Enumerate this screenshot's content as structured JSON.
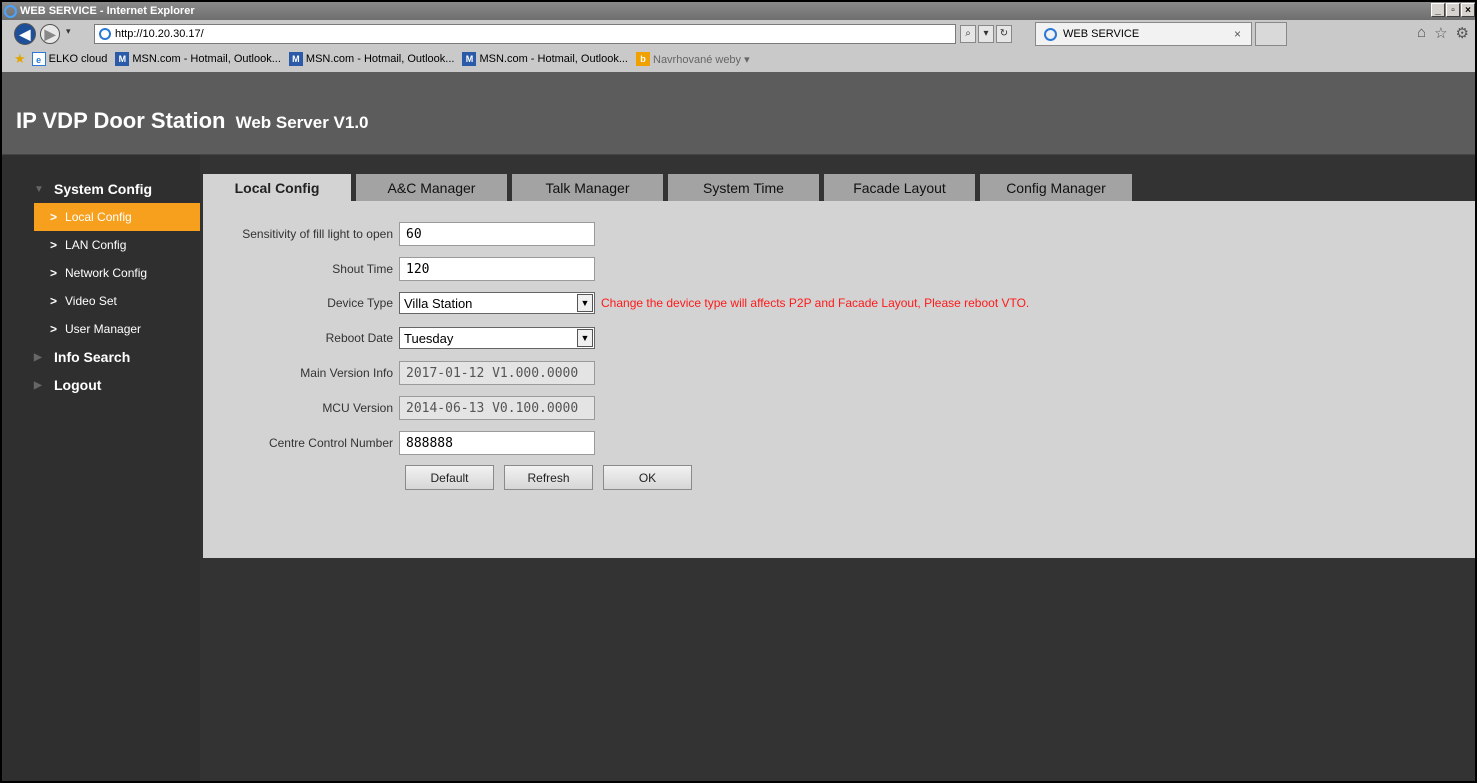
{
  "window": {
    "title": "WEB SERVICE - Internet Explorer",
    "min": "_",
    "max": "▫",
    "close": "×"
  },
  "browser": {
    "back": "◀",
    "forward": "▶",
    "url": "http://10.20.30.17/",
    "search_glyph": "⌕",
    "dropdown_glyph": "▾",
    "refresh_glyph": "↻",
    "tab_title": "WEB SERVICE",
    "tab_close": "×",
    "tools": {
      "home": "⌂",
      "favorites": "☆",
      "settings": "⚙"
    }
  },
  "favorites": [
    {
      "label": "ELKO cloud",
      "icon": "e"
    },
    {
      "label": "MSN.com - Hotmail, Outlook...",
      "icon": "M"
    },
    {
      "label": "MSN.com - Hotmail, Outlook...",
      "icon": "M"
    },
    {
      "label": "MSN.com - Hotmail, Outlook...",
      "icon": "M"
    },
    {
      "label": "Navrhované weby ▾",
      "icon": "b"
    }
  ],
  "app": {
    "title": "IP VDP Door Station",
    "subtitle": "Web Server V1.0"
  },
  "sidebar": {
    "system_config": "System Config",
    "items": [
      {
        "label": "Local Config",
        "active": true
      },
      {
        "label": "LAN Config"
      },
      {
        "label": "Network Config"
      },
      {
        "label": "Video Set"
      },
      {
        "label": "User Manager"
      }
    ],
    "info_search": "Info Search",
    "logout": "Logout"
  },
  "tabs": [
    "Local Config",
    "A&C Manager",
    "Talk Manager",
    "System Time",
    "Facade Layout",
    "Config Manager"
  ],
  "form": {
    "sensitivity": {
      "label": "Sensitivity of fill light to open",
      "value": "60"
    },
    "shout_time": {
      "label": "Shout Time",
      "value": "120"
    },
    "device_type": {
      "label": "Device Type",
      "value": "Villa Station",
      "warning": "Change the device type will affects P2P and Facade Layout, Please reboot VTO."
    },
    "reboot_date": {
      "label": "Reboot Date",
      "value": "Tuesday"
    },
    "main_version": {
      "label": "Main Version Info",
      "value": "2017-01-12 V1.000.0000"
    },
    "mcu_version": {
      "label": "MCU Version",
      "value": "2014-06-13 V0.100.0000"
    },
    "centre_number": {
      "label": "Centre Control Number",
      "value": "888888"
    }
  },
  "buttons": {
    "default": "Default",
    "refresh": "Refresh",
    "ok": "OK"
  },
  "colors": {
    "accent": "#f7a01e",
    "warning": "#ff1a1a",
    "panel": "#d3d3d3"
  }
}
